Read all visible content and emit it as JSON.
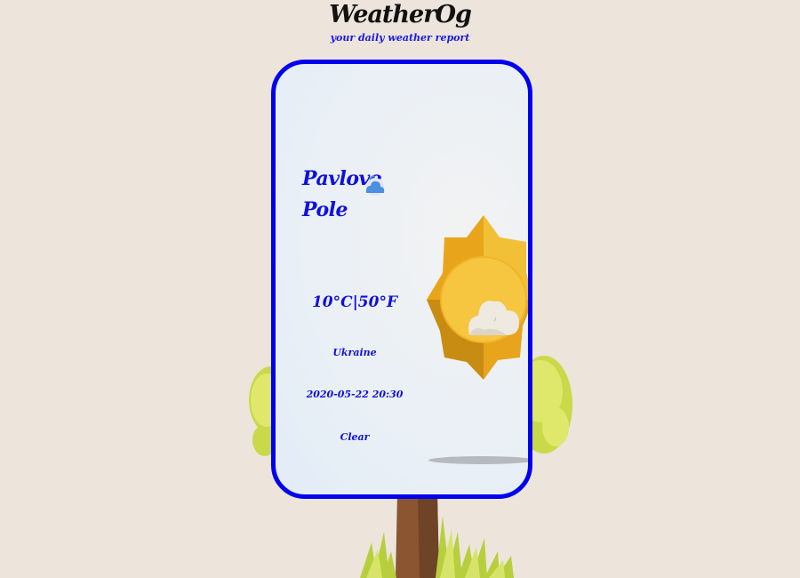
{
  "app": {
    "title": "WeatherOg",
    "subtitle": "your daily weather report"
  },
  "weather": {
    "city": "Pavlove Pole",
    "temperature": "10°C|50°F",
    "country": "Ukraine",
    "datetime": "2020-05-22 20:30",
    "description": "Clear",
    "small_icon": "cloud-icon",
    "big_icon": "sun-cloud-icon"
  },
  "colors": {
    "background": "#ede4db",
    "card_border": "#0000ee",
    "text_accent": "#1010dd",
    "sun": "#f6c13a"
  }
}
